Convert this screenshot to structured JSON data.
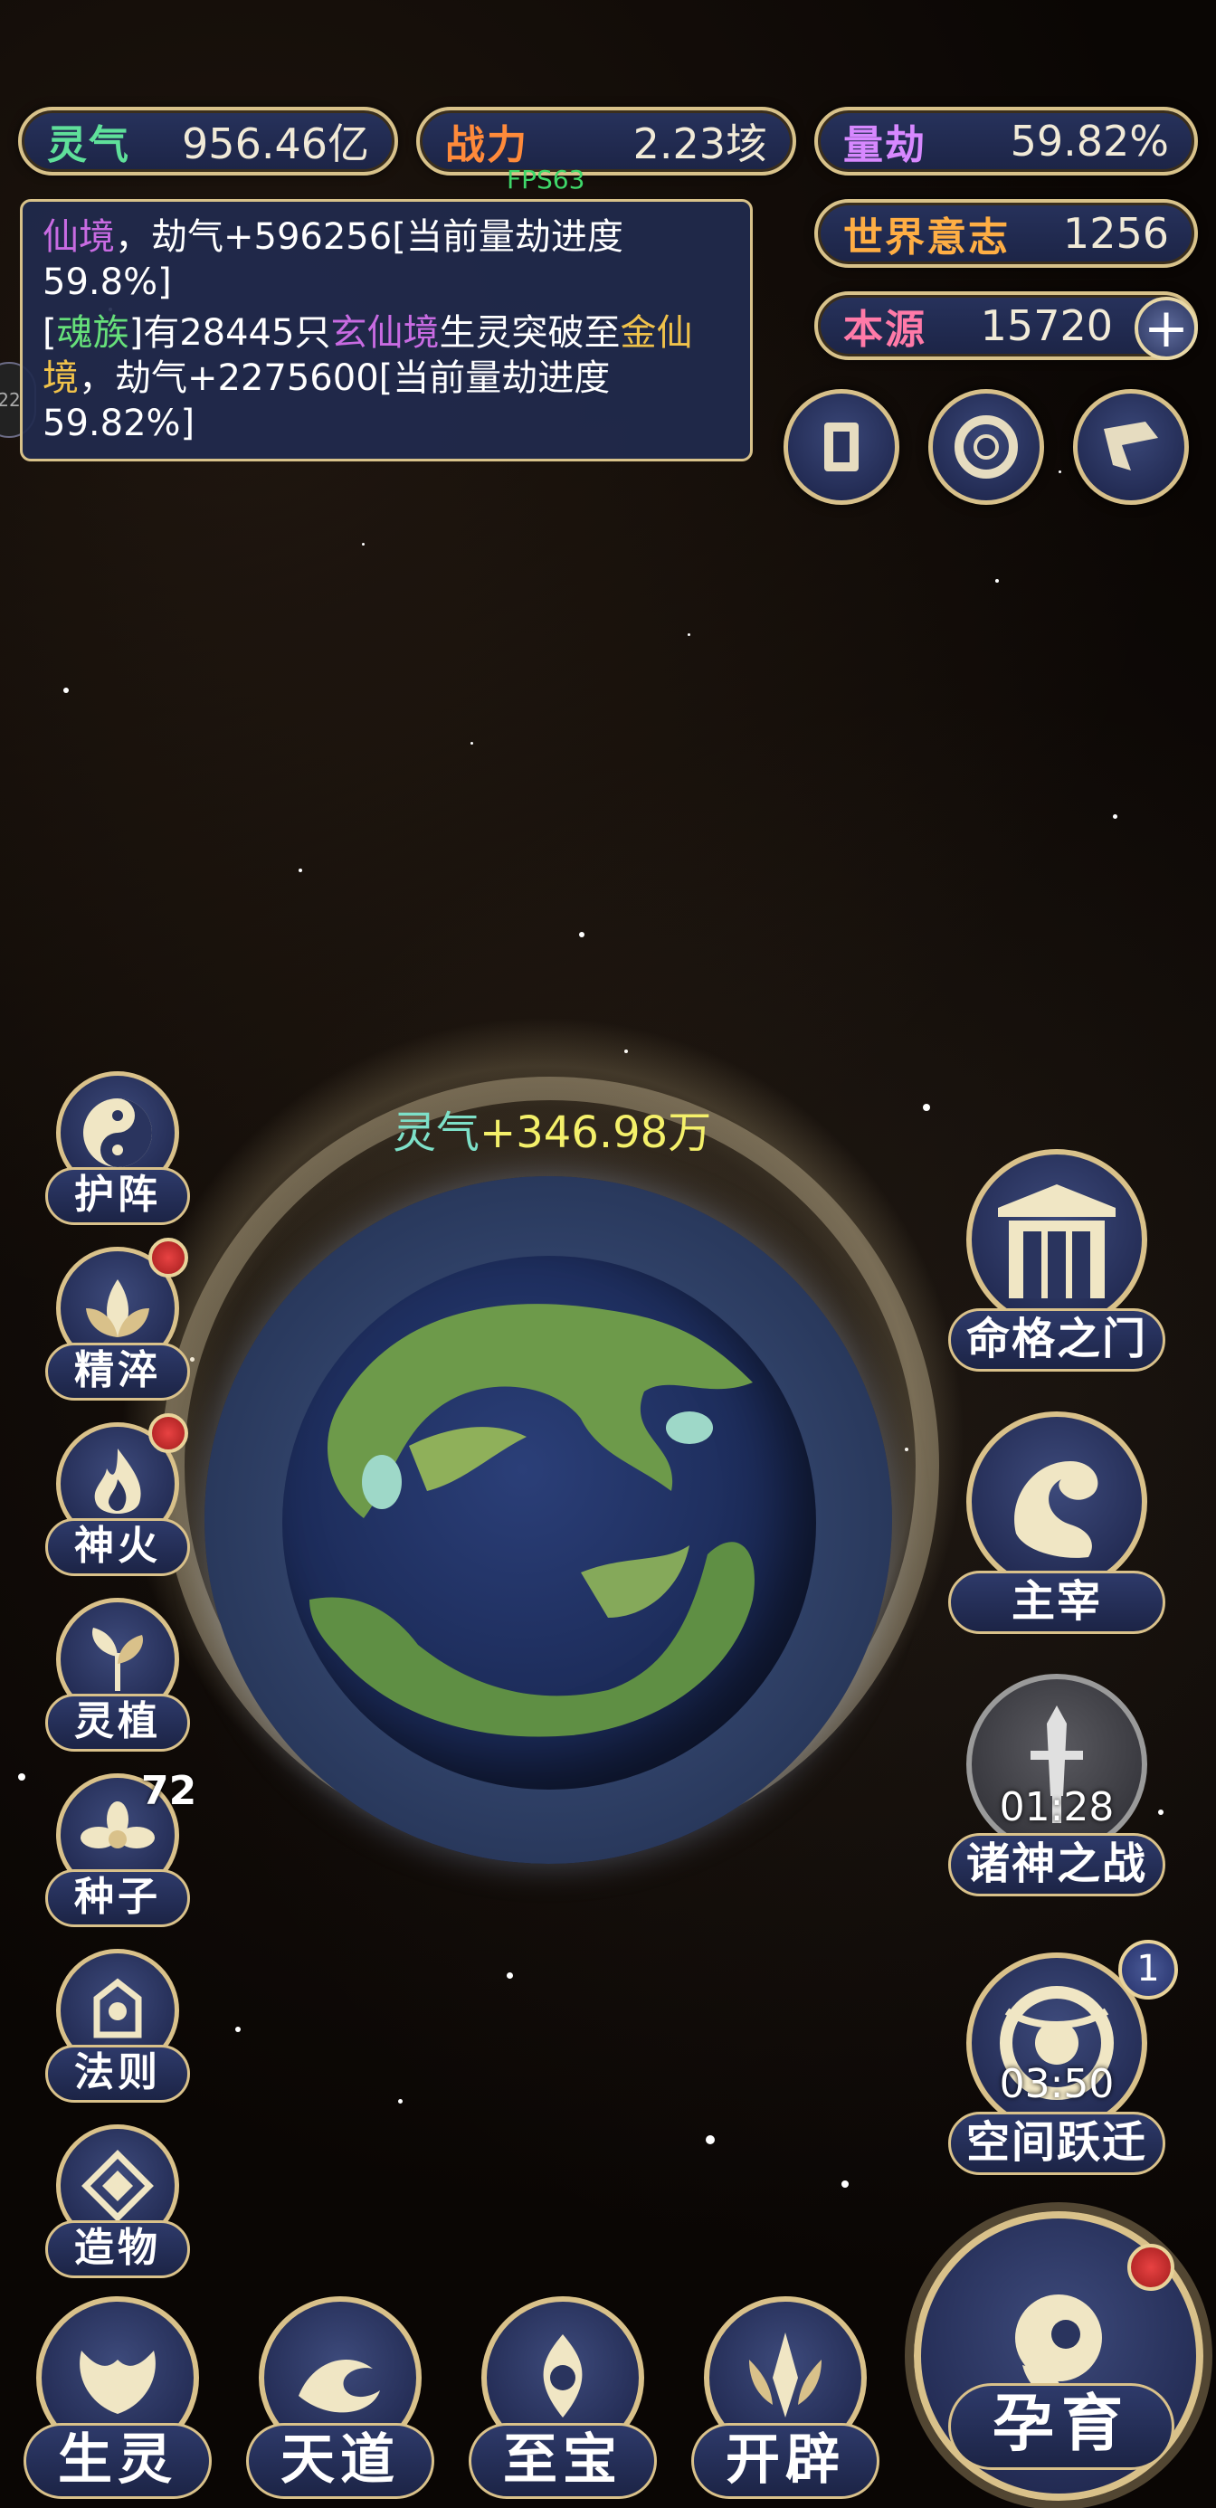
{
  "stats": {
    "lingqi": {
      "label": "灵气",
      "value": "956.46亿",
      "color": "#5fe09a"
    },
    "zhanli": {
      "label": "战力",
      "value": "2.23垓",
      "color": "#ff8a3a"
    },
    "liangjie": {
      "label": "量劫",
      "value": "59.82%",
      "color": "#d788ff"
    },
    "shijie": {
      "label": "世界意志",
      "value": "1256",
      "color": "#ffae44"
    },
    "benyuan": {
      "label": "本源",
      "value": "15720",
      "color": "#ff7aa8"
    }
  },
  "fps": "FPS63",
  "edge_tab": "22",
  "log": {
    "line1": {
      "a": "仙境",
      "b": "，劫气+596256[当前量劫进度59.8%]"
    },
    "line2": {
      "a": "[",
      "b": "魂族",
      "c": "]有28445只",
      "d": "玄仙境",
      "e": "生灵突破至",
      "f": "金",
      "g": "仙境",
      "h": "，劫气+2275600[当前量劫进度59.82%]"
    }
  },
  "planet": {
    "gain_label": "灵气",
    "gain_value": "+346.98万"
  },
  "left_buttons": [
    {
      "label": "护阵",
      "icon": "yin-yang-icon"
    },
    {
      "label": "精淬",
      "icon": "lotus-icon"
    },
    {
      "label": "神火",
      "icon": "flame-icon"
    },
    {
      "label": "灵植",
      "icon": "plant-icon"
    },
    {
      "label": "种子",
      "icon": "flower-icon",
      "count": "72"
    },
    {
      "label": "法则",
      "icon": "rune-icon"
    },
    {
      "label": "造物",
      "icon": "diamond-icon"
    }
  ],
  "right_buttons": [
    {
      "label": "命格之门",
      "icon": "gate-icon"
    },
    {
      "label": "主宰",
      "icon": "dragon-icon"
    },
    {
      "label": "诸神之战",
      "icon": "sword-icon",
      "timer": "01:28"
    },
    {
      "label": "空间跃迁",
      "icon": "portal-icon",
      "timer": "03:50",
      "count": "1"
    }
  ],
  "bottom_buttons": [
    {
      "label": "生灵",
      "icon": "phoenix-icon"
    },
    {
      "label": "天道",
      "icon": "wave-icon"
    },
    {
      "label": "至宝",
      "icon": "treasure-icon"
    },
    {
      "label": "开辟",
      "icon": "axe-icon"
    }
  ],
  "main_button": {
    "label": "孕育",
    "icon": "embryo-icon"
  },
  "colors": {
    "gold": "#d9c18a",
    "panel": "#1c2446",
    "gain": "#f4f06a"
  }
}
